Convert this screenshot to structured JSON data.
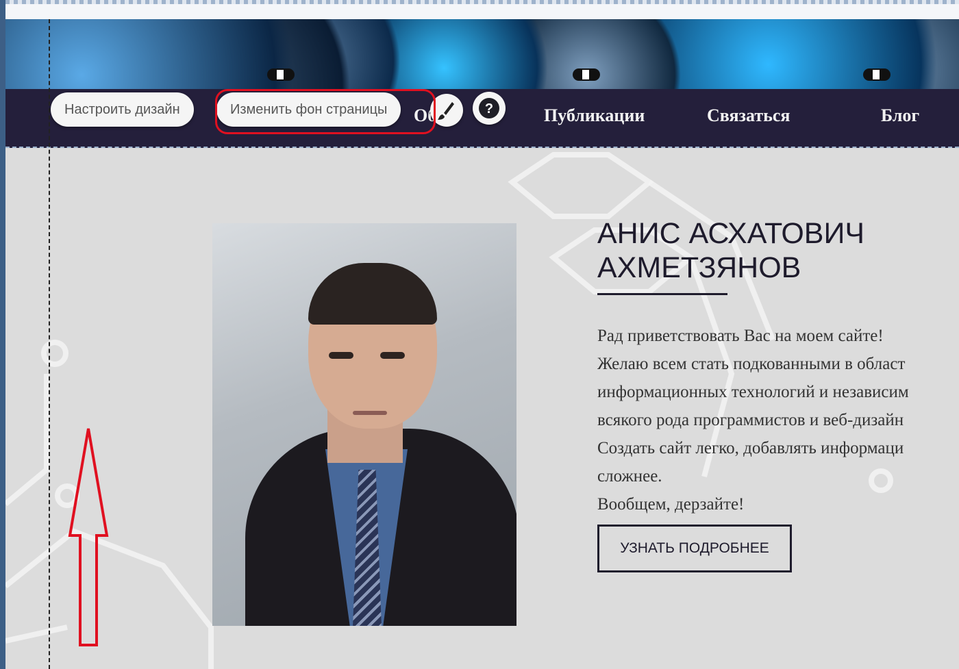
{
  "toolbar": {
    "customize_design": "Настроить дизайн",
    "change_background": "Изменить фон страницы"
  },
  "nav": {
    "items": [
      "Об",
      "Публикации",
      "Связаться",
      "Блог"
    ]
  },
  "hero": {
    "name_line1": "АНИС АСХАТОВИЧ",
    "name_line2": "АХМЕТЗЯНОВ",
    "paragraph": [
      "Рад приветствовать Вас на моем сайте!",
      "Желаю всем стать подкованными в област",
      "информационных технологий и независим",
      "всякого рода программистов и веб-дизайн",
      "Создать сайт легко, добавлять информаци",
      "сложнее.",
      "Вообщем, дерзайте!"
    ],
    "button": "УЗНАТЬ ПОДРОБНЕЕ"
  },
  "icons": [
    "brush-icon",
    "question-icon"
  ],
  "colors": {
    "navbar": "#241f3b",
    "highlight": "#e01020",
    "page_bg": "#dcdcdc"
  }
}
